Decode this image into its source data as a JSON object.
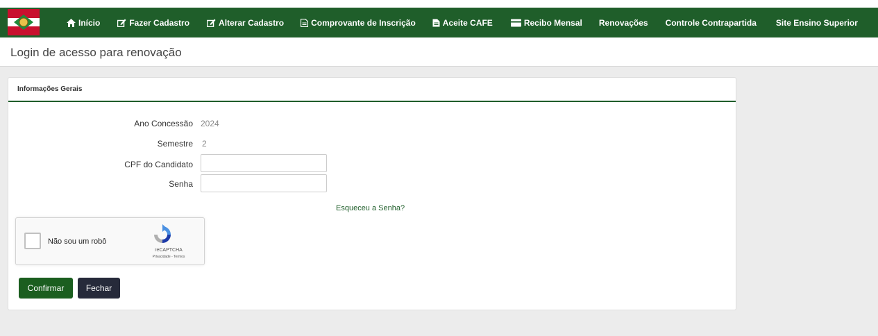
{
  "nav": {
    "items": [
      {
        "label": "Início",
        "icon": "home-icon"
      },
      {
        "label": "Fazer Cadastro",
        "icon": "edit-icon"
      },
      {
        "label": "Alterar Cadastro",
        "icon": "edit-icon"
      },
      {
        "label": "Comprovante de Inscrição",
        "icon": "document-icon"
      },
      {
        "label": "Aceite CAFE",
        "icon": "document-icon"
      },
      {
        "label": "Recibo Mensal",
        "icon": "card-icon"
      },
      {
        "label": "Renovações",
        "icon": ""
      },
      {
        "label": "Controle Contrapartida",
        "icon": ""
      },
      {
        "label": "Site Ensino Superior",
        "icon": ""
      }
    ]
  },
  "page": {
    "title": "Login de acesso para renovação"
  },
  "panel": {
    "heading": "Informações Gerais"
  },
  "form": {
    "ano_label": "Ano Concessão",
    "ano_value": "2024",
    "semestre_label": "Semestre",
    "semestre_value": "2",
    "cpf_label": "CPF do Candidato",
    "cpf_value": "",
    "senha_label": "Senha",
    "senha_value": "",
    "forgot_label": "Esqueceu a Senha?"
  },
  "captcha": {
    "label": "Não sou um robô",
    "brand": "reCAPTCHA",
    "terms": "Privacidade - Termos"
  },
  "buttons": {
    "confirm": "Confirmar",
    "close": "Fechar"
  },
  "colors": {
    "brand_green": "#1f5e2a",
    "confirm_green": "#1b5e1f",
    "close_dark": "#262a3a"
  }
}
